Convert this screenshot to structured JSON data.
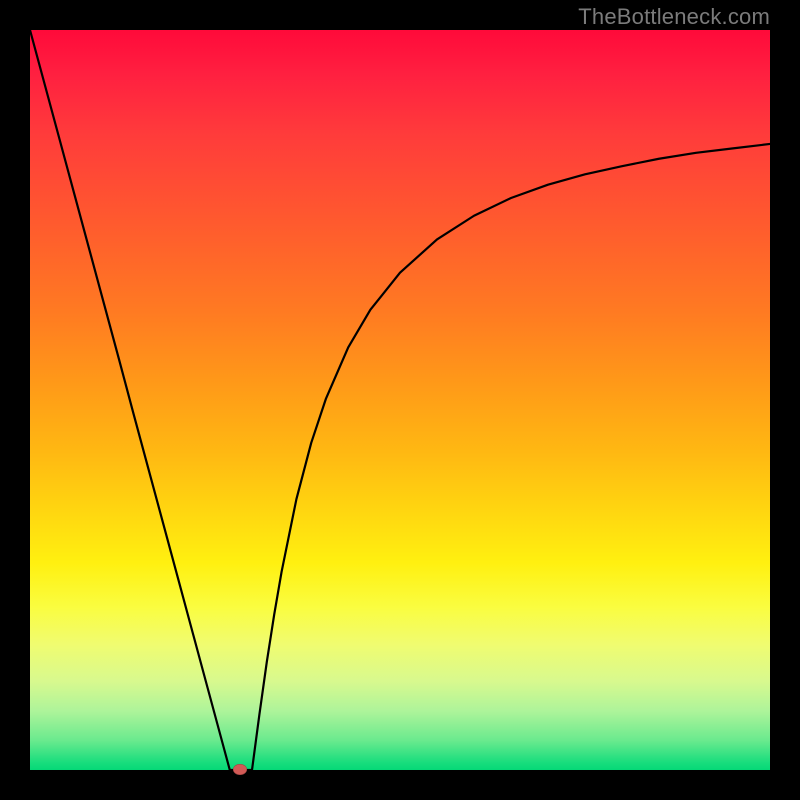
{
  "watermark": "TheBottleneck.com",
  "colors": {
    "frame": "#000000",
    "curve": "#000000",
    "marker": "#d15a56"
  },
  "chart_data": {
    "type": "line",
    "title": "",
    "xlabel": "",
    "ylabel": "",
    "xlim": [
      0,
      100
    ],
    "ylim": [
      0,
      100
    ],
    "grid": false,
    "legend": false,
    "series": [
      {
        "name": "bottleneck-curve",
        "x": [
          0,
          2,
          4,
          6,
          8,
          10,
          12,
          14,
          16,
          18,
          20,
          22,
          24,
          26,
          27,
          28,
          29,
          30,
          31,
          32,
          33,
          34,
          36,
          38,
          40,
          43,
          46,
          50,
          55,
          60,
          65,
          70,
          75,
          80,
          85,
          90,
          95,
          100
        ],
        "y": [
          100,
          92.6,
          85.2,
          77.8,
          70.4,
          63.0,
          55.6,
          48.1,
          40.7,
          33.3,
          25.9,
          18.5,
          11.1,
          3.7,
          0.0,
          0.0,
          0.0,
          0.0,
          7.5,
          14.6,
          21.0,
          26.8,
          36.6,
          44.2,
          50.2,
          57.1,
          62.2,
          67.2,
          71.7,
          74.9,
          77.3,
          79.1,
          80.5,
          81.6,
          82.6,
          83.4,
          84.0,
          84.6
        ]
      }
    ],
    "marker": {
      "x": 28.4,
      "y": 0.0
    }
  }
}
